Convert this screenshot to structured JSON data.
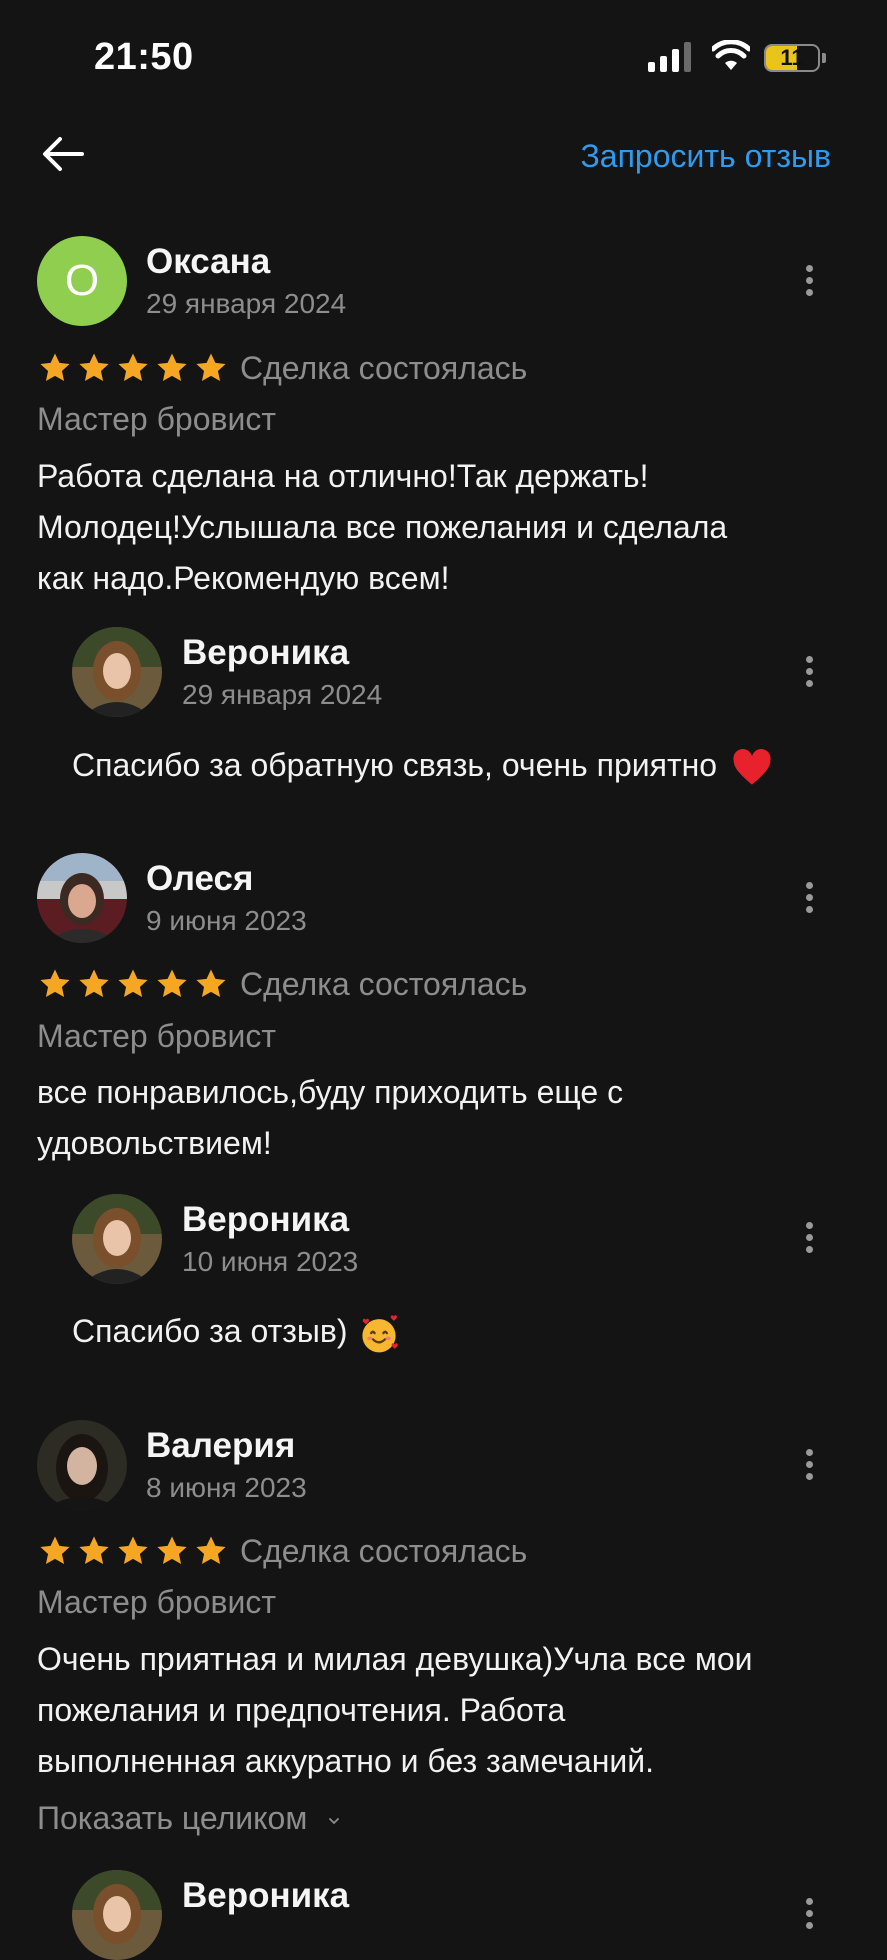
{
  "status_bar": {
    "time": "21:50",
    "battery": "11",
    "battery_level_percent": 11
  },
  "header": {
    "request_review_label": "Запросить отзыв"
  },
  "reviews": [
    {
      "avatar_letter": "О",
      "name": "Оксана",
      "date": "29 января 2024",
      "rating": 5,
      "deal_status": "Сделка состоялась",
      "service": "Мастер бровист",
      "text_lines": [
        "Работа сделана на отлично!Так держать!",
        "Молодец!Услышала все пожелания и сделала",
        "как надо.Рекомендую всем!"
      ],
      "reply": {
        "name": "Вероника",
        "date": "29 января 2024",
        "text": "Спасибо за обратную связь,  очень приятно"
      }
    },
    {
      "name": "Олеся",
      "date": "9 июня 2023",
      "rating": 5,
      "deal_status": "Сделка состоялась",
      "service": "Мастер бровист",
      "text_lines": [
        "все понравилось,буду приходить еще с",
        "удовольствием!"
      ],
      "reply": {
        "name": "Вероника",
        "date": "10 июня 2023",
        "text": "Спасибо за отзыв)"
      }
    },
    {
      "name": "Валерия",
      "date": "8 июня 2023",
      "rating": 5,
      "deal_status": "Сделка состоялась",
      "service": "Мастер бровист",
      "text_lines": [
        "Очень приятная и милая девушка)Учла все мои",
        "пожелания и предпочтения. Работа",
        "выполненная аккуратно и без замечаний."
      ],
      "show_more_label": "Показать целиком",
      "reply": {
        "name": "Вероника"
      }
    }
  ],
  "colors": {
    "background": "#141414",
    "accent": "#2f9bee",
    "star": "#f5a623",
    "muted_text": "#8d8d8d",
    "avatar_letter_bg": "#8fce4e"
  },
  "icons": [
    "back-arrow-icon",
    "more-vertical-icon",
    "star-icon",
    "heart-emoji",
    "smiling-face-with-hearts-emoji",
    "chevron-down-icon",
    "signal-icon",
    "wifi-icon",
    "battery-icon"
  ]
}
